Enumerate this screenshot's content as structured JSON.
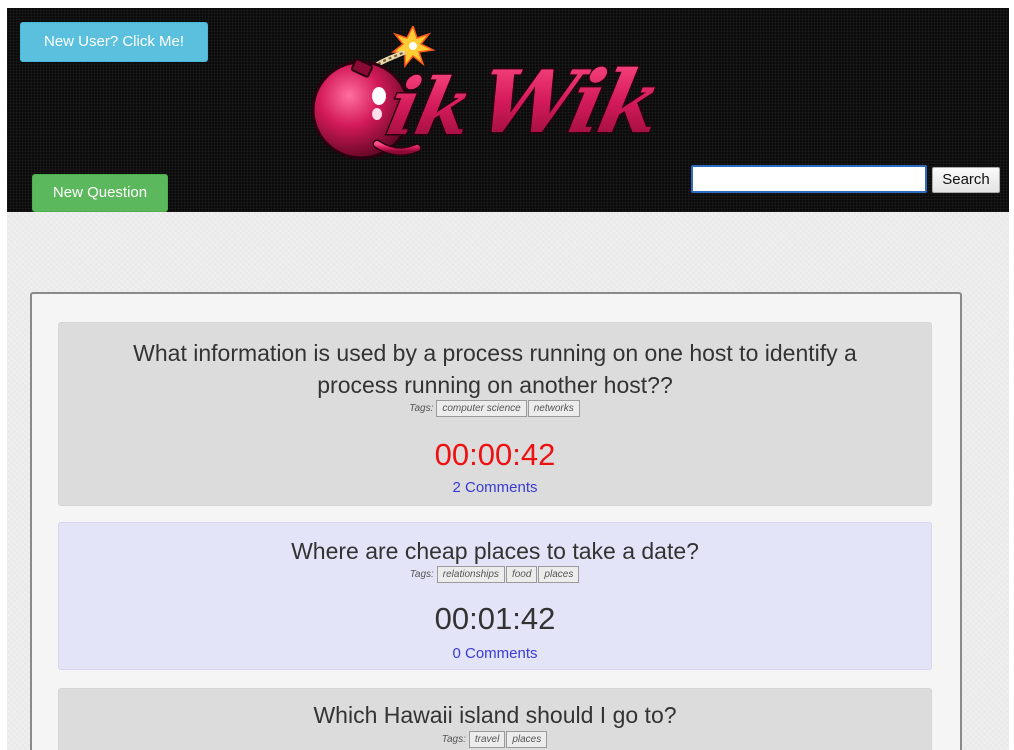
{
  "header": {
    "new_user_label": "New User? Click Me!",
    "new_question_label": "New Question",
    "logo_text": "QikWik",
    "search": {
      "value": "",
      "placeholder": "",
      "button_label": "Search"
    },
    "colors": {
      "logo_pink": "#d41a5a",
      "bomb": "#c8104a",
      "spark": "#ffcc33"
    }
  },
  "questions": [
    {
      "title_line1": "What information is used by a process running on one host to identify a",
      "title_line2": "process running on another host??",
      "tags_label": "Tags:",
      "tags": [
        "computer science",
        "networks"
      ],
      "timer": "00:00:42",
      "timer_color": "#ee1111",
      "comments": "2 Comments"
    },
    {
      "title": "Where are cheap places to take a date?",
      "tags_label": "Tags:",
      "tags": [
        "relationships",
        "food",
        "places"
      ],
      "timer": "00:01:42",
      "timer_color": "#333333",
      "comments": "0 Comments"
    },
    {
      "title": "Which Hawaii island should I go to?",
      "tags_label": "Tags:",
      "tags": [
        "travel",
        "places"
      ]
    }
  ]
}
